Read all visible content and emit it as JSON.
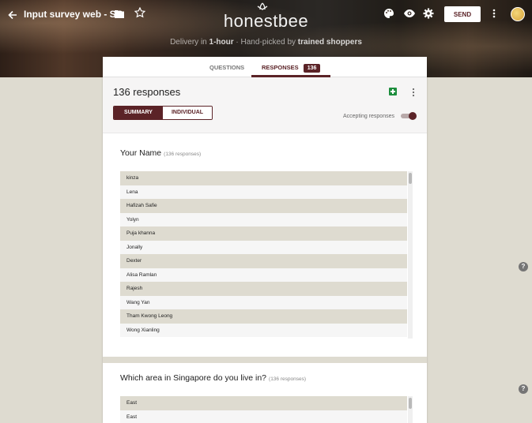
{
  "header": {
    "doc_title": "Input survey web - SG",
    "brand": "honestbee",
    "tagline_parts": [
      "Delivery in ",
      "1-hour",
      " · Hand-picked by ",
      "trained shoppers"
    ],
    "send_label": "SEND"
  },
  "tabs": {
    "questions_label": "QUESTIONS",
    "responses_label": "RESPONSES",
    "responses_count": "136"
  },
  "responses": {
    "title": "136 responses",
    "summary_label": "SUMMARY",
    "individual_label": "INDIVIDUAL",
    "accepting_label": "Accepting responses",
    "accepting": true
  },
  "questions": [
    {
      "title": "Your Name",
      "count": "(136 responses)",
      "answers": [
        "kinza",
        "Lena",
        "Hafizah Safie",
        "Yolyn",
        "Puja khanna",
        "Jonally",
        "Dexter",
        "Alisa Ramlan",
        "Rajesh",
        "Wang Yan",
        "Tham Kwong Leong",
        "Wong Xianling"
      ]
    },
    {
      "title": "Which area in Singapore do you live in?",
      "count": "(136 responses)",
      "answers": [
        "East",
        "East"
      ]
    }
  ],
  "colors": {
    "accent": "#5b2327",
    "page_bg": "#dedbd0"
  },
  "icons": [
    "back-arrow-icon",
    "folder-icon",
    "star-icon",
    "palette-icon",
    "eye-icon",
    "gear-icon",
    "more-vert-icon",
    "sheets-icon",
    "help-icon"
  ]
}
